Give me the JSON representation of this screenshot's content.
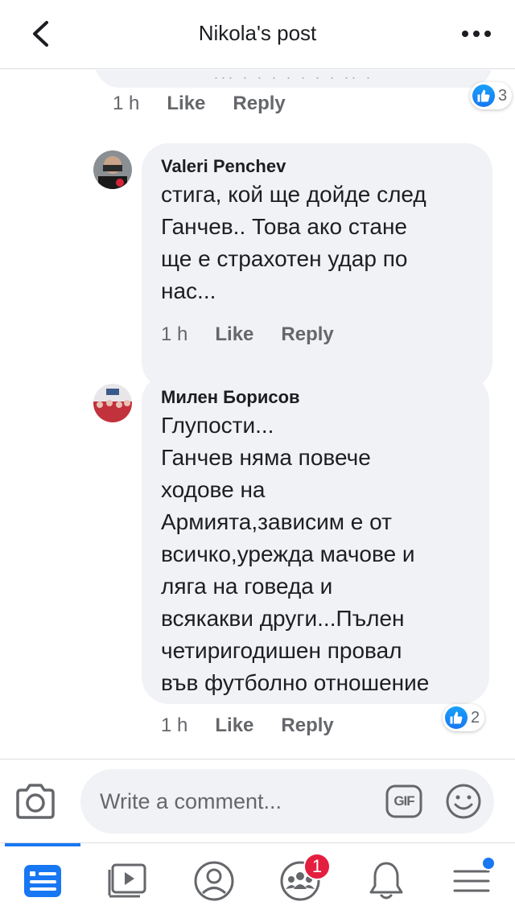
{
  "header": {
    "title": "Nikola's post",
    "back_icon": "chevron-left-icon",
    "more_icon": "more-horizontal-icon"
  },
  "comments": [
    {
      "truncated": true,
      "partial_text": "...  .  . . . . . . .. .",
      "time": "1 h",
      "like_label": "Like",
      "reply_label": "Reply",
      "reaction_count": "3"
    },
    {
      "author": "Valeri Penchev",
      "text": "стига, кой ще дойде след\nГанчев.. Това ако стане\nще е страхотен удар по\nнас...",
      "time": "1 h",
      "like_label": "Like",
      "reply_label": "Reply"
    },
    {
      "author": "Милен Борисов",
      "text": "Глупости...\nГанчев няма повече\nходове на\nАрмията,зависим е от\nвсичко,урежда мачове и\nляга на говеда и\nвсякакви други...Пълен\nчетиригодишен провал\nвъв футболно отношение",
      "time": "1 h",
      "like_label": "Like",
      "reply_label": "Reply",
      "reaction_count": "2"
    }
  ],
  "composer": {
    "placeholder": "Write a comment...",
    "camera_icon": "camera-icon",
    "gif_label": "GIF",
    "emoji_icon": "smiley-icon"
  },
  "tabbar": {
    "active": "news-feed",
    "tabs": [
      {
        "name": "news-feed",
        "icon": "news-feed-icon"
      },
      {
        "name": "watch",
        "icon": "video-icon"
      },
      {
        "name": "profile",
        "icon": "profile-icon"
      },
      {
        "name": "groups",
        "icon": "groups-icon",
        "badge": "1"
      },
      {
        "name": "notifications",
        "icon": "bell-icon"
      },
      {
        "name": "menu",
        "icon": "menu-icon"
      }
    ]
  },
  "colors": {
    "accent": "#1877f2",
    "bubble": "#f0f2f5",
    "secondary_text": "#65676b",
    "badge": "#e41e3f"
  }
}
